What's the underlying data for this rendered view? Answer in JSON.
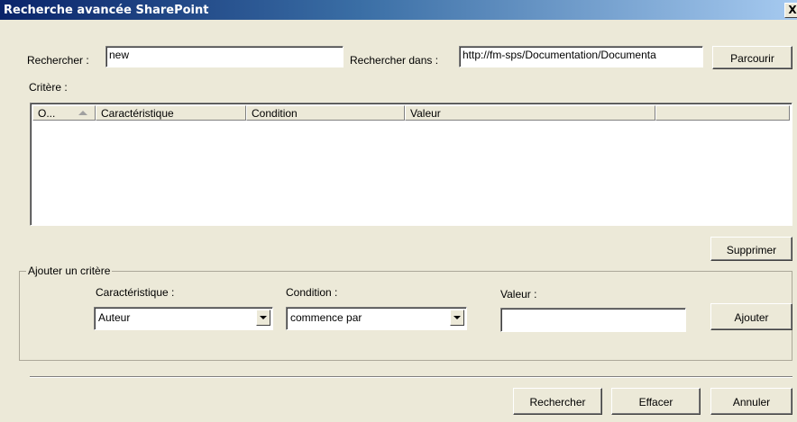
{
  "window": {
    "title": "Recherche avancée SharePoint",
    "close_label": "X"
  },
  "search": {
    "label": "Rechercher :",
    "value": "new",
    "in_label": "Rechercher dans :",
    "in_value": "http://fm-sps/Documentation/Documenta",
    "browse_label": "Parcourir"
  },
  "criteria": {
    "label": "Critère :",
    "columns": [
      "O...",
      "Caractéristique",
      "Condition",
      "Valeur",
      ""
    ],
    "rows": [],
    "delete_label": "Supprimer"
  },
  "add_criteria": {
    "group_label": "Ajouter un critère",
    "property_label": "Caractéristique :",
    "property_value": "Auteur",
    "condition_label": "Condition :",
    "condition_value": "commence par",
    "value_label": "Valeur :",
    "value_value": "",
    "add_label": "Ajouter"
  },
  "footer": {
    "search_label": "Rechercher",
    "clear_label": "Effacer",
    "cancel_label": "Annuler"
  }
}
